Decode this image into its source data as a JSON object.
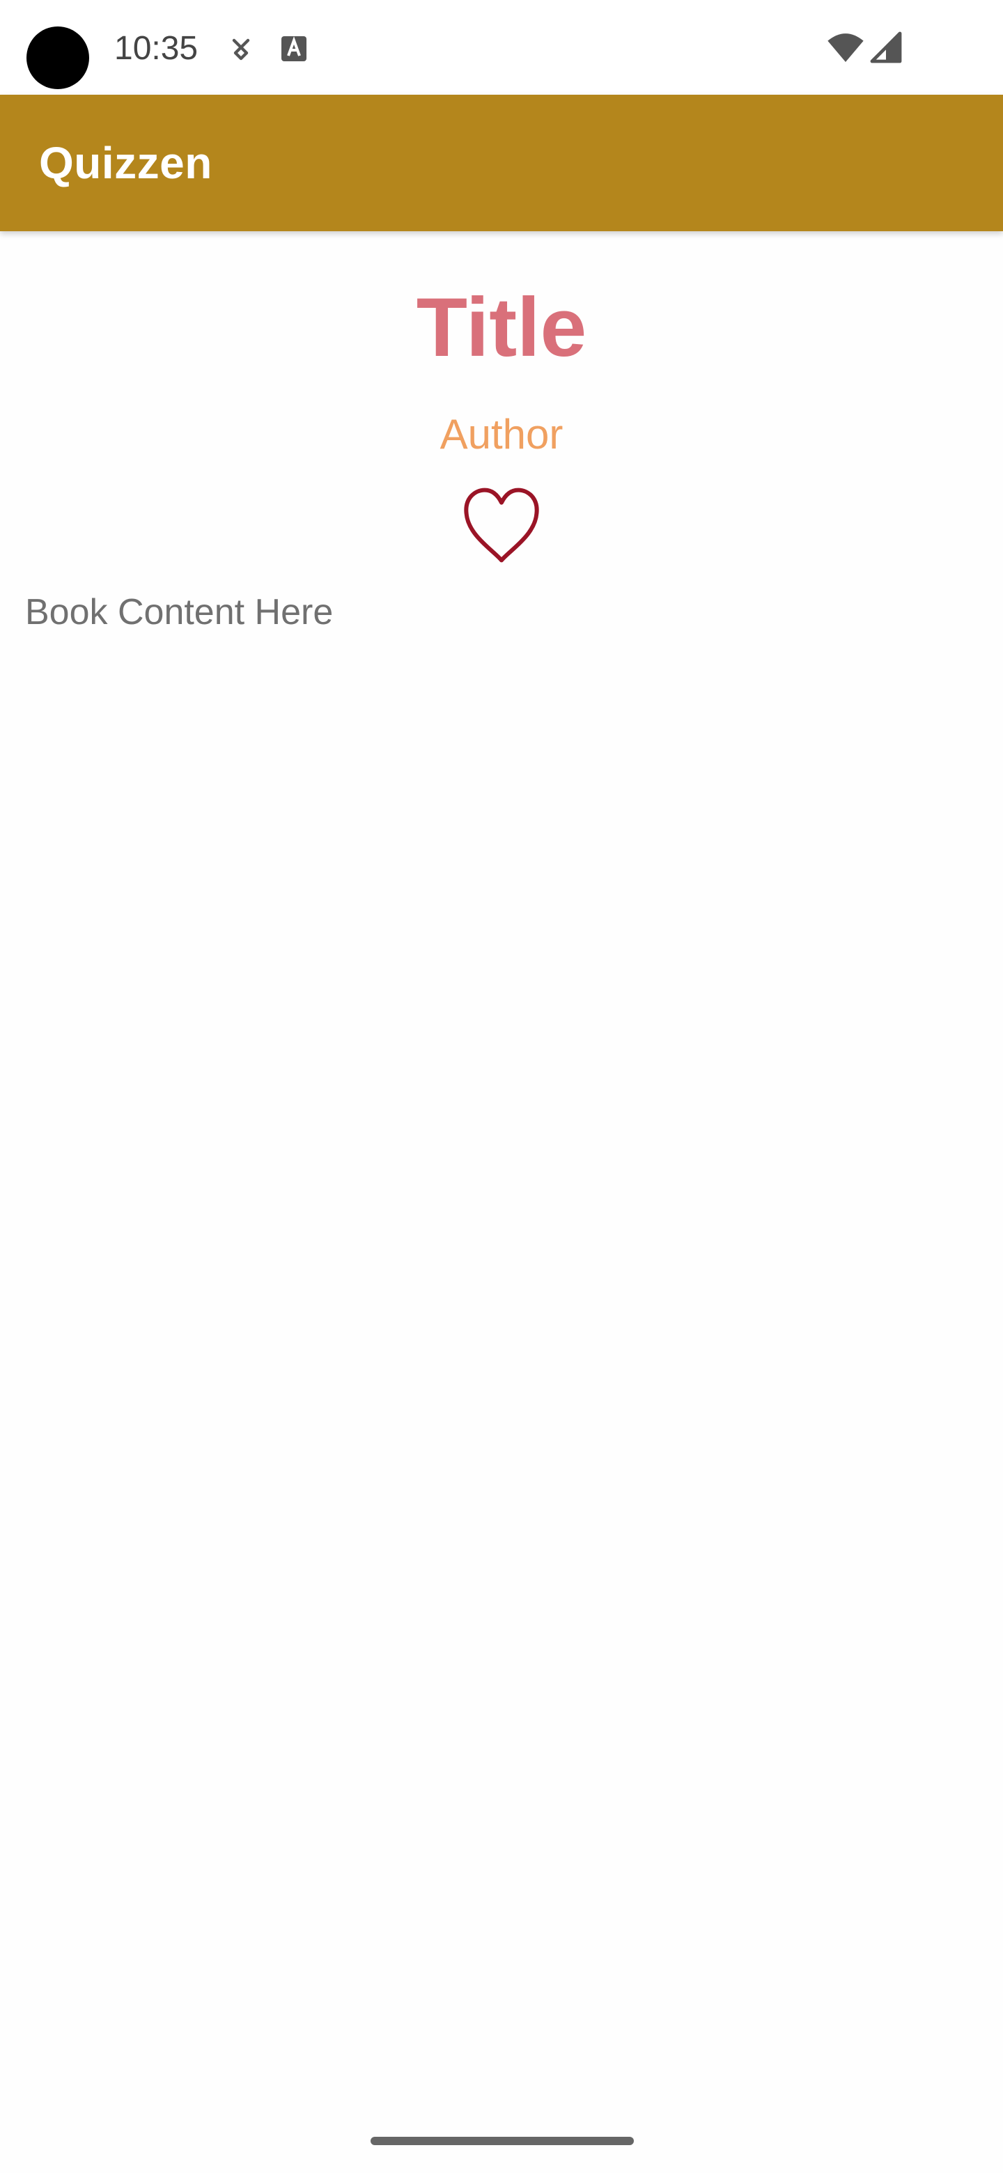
{
  "status_bar": {
    "time": "10:35",
    "icons": [
      "camera-cutout",
      "download-icon",
      "a11y-text-icon",
      "wifi-icon",
      "cell-signal-icon"
    ]
  },
  "app_bar": {
    "title": "Quizzen",
    "color": "#b4861c"
  },
  "book": {
    "title": "Title",
    "author": "Author",
    "favorite_icon": "heart-outline-icon",
    "content": "Book Content Here",
    "title_color": "#d9707a",
    "author_color": "#f0a060",
    "heart_color": "#9a1426"
  }
}
